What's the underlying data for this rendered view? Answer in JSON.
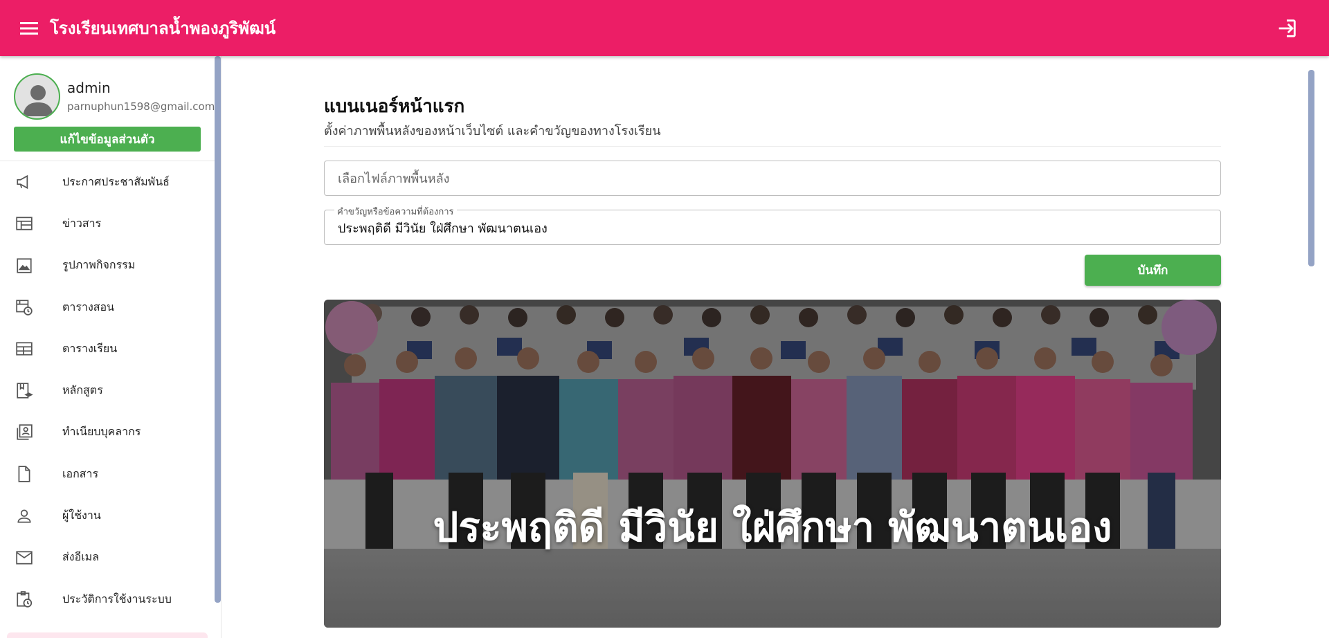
{
  "app": {
    "title": "โรงเรียนเทศบาลน้ำพองภูริพัฒน์",
    "bar_color": "#ec1e66",
    "menu_icon": "menu-icon",
    "login_icon": "login-icon"
  },
  "profile": {
    "name": "admin",
    "email": "parnuphun1598@gmail.com",
    "edit_label": "แก้ไขข้อมูลส่วนตัว"
  },
  "sidebar": {
    "items": [
      {
        "label": "ประกาศประชาสัมพันธ์",
        "icon": "megaphone-icon"
      },
      {
        "label": "ข่าวสาร",
        "icon": "newspaper-icon"
      },
      {
        "label": "รูปภาพกิจกรรม",
        "icon": "image-icon"
      },
      {
        "label": "ตารางสอน",
        "icon": "calendar-clock-icon"
      },
      {
        "label": "ตารางเรียน",
        "icon": "table-icon"
      },
      {
        "label": "หลักสูตร",
        "icon": "curriculum-icon"
      },
      {
        "label": "ทำเนียบบุคลากร",
        "icon": "staff-directory-icon"
      },
      {
        "label": "เอกสาร",
        "icon": "document-icon"
      },
      {
        "label": "ผู้ใช้งาน",
        "icon": "user-icon"
      },
      {
        "label": "ส่งอีเมล",
        "icon": "mail-icon"
      },
      {
        "label": "ประวัติการใช้งานระบบ",
        "icon": "history-icon"
      }
    ]
  },
  "main": {
    "heading": "แบนเนอร์หน้าแรก",
    "subheading": "ตั้งค่าภาพพื้นหลังของหน้าเว็บไซต์ และคำขวัญของทางโรงเรียน",
    "file_placeholder": "เลือกไฟล์ภาพพื้นหลัง",
    "motto_label": "คำขวัญหรือข้อความที่ต้องการ",
    "motto_value": "ประพฤติดี มีวินัย ใฝ่ศึกษา พัฒนาตนเอง",
    "save_label": "บันทึก",
    "banner_text": "ประพฤติดี มีวินัย ใฝ่ศึกษา พัฒนาตนเอง",
    "accent_green": "#4caf50"
  }
}
